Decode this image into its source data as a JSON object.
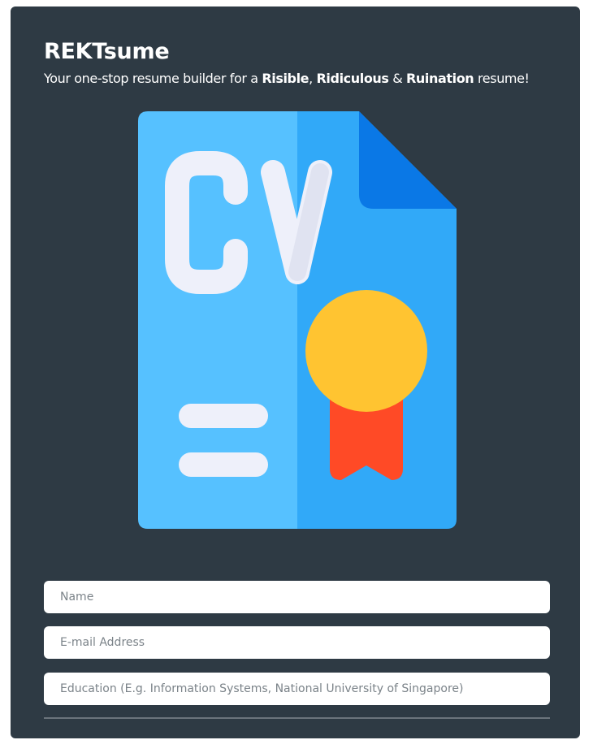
{
  "header": {
    "title": "REKTsume",
    "subtitle_prefix": "Your one-stop resume builder for a ",
    "word1": "Risible",
    "sep1": ", ",
    "word2": "Ridiculous",
    "sep2": " & ",
    "word3": "Ruination",
    "subtitle_suffix": " resume!"
  },
  "illustration": {
    "icon": "cv-document-icon",
    "text": "CV"
  },
  "form": {
    "name_placeholder": "Name",
    "email_placeholder": "E-mail Address",
    "education_placeholder": "Education (E.g. Information Systems, National University of Singapore)"
  },
  "colors": {
    "background": "#2e3a44",
    "doc_light": "#56c1ff",
    "doc_mid": "#31a9f8",
    "doc_fold": "#0a78e6",
    "cv_text": "#eef0fa",
    "medal": "#ffc431",
    "ribbon": "#ff4a26"
  }
}
